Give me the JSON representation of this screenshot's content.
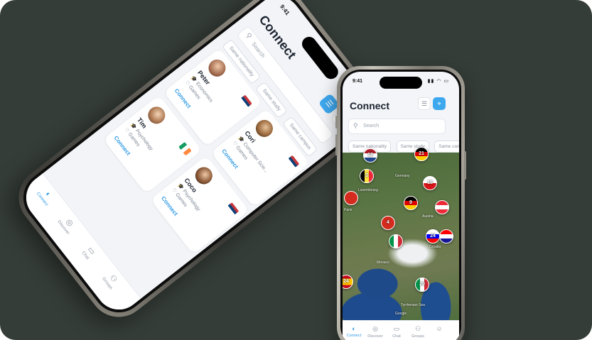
{
  "left_phone": {
    "time": "9:41",
    "title": "Connect",
    "search_placeholder": "Search",
    "filters": [
      "Same nationality",
      "Same study",
      "Same campus"
    ],
    "cards": [
      {
        "name": "Peter",
        "study": "Economics",
        "interest": "Games",
        "action": "Connect",
        "flag": "serbia"
      },
      {
        "name": "Cori",
        "study": "Computer Scie...",
        "interest": "Games",
        "action": "Connect",
        "flag": "serbia"
      },
      {
        "name": "Tim",
        "study": "Psychology",
        "interest": "Games",
        "action": "Connect",
        "flag": "ireland"
      },
      {
        "name": "Coco",
        "study": "Psychology",
        "interest": "Games",
        "action": "Connect",
        "flag": "serbia"
      }
    ],
    "tabs": [
      {
        "label": "Connect",
        "icon": "connect-icon",
        "active": true
      },
      {
        "label": "Discover",
        "icon": "compass-icon",
        "active": false
      },
      {
        "label": "Chat",
        "icon": "chat-icon",
        "active": false
      },
      {
        "label": "Groups",
        "icon": "groups-icon",
        "active": false
      }
    ]
  },
  "right_phone": {
    "time": "9:41",
    "title": "Connect",
    "search_placeholder": "Search",
    "filters": [
      "Same nationality",
      "Same study",
      "Same campus"
    ],
    "map_labels": [
      "Germany",
      "Luxembourg",
      "Paris",
      "Austria",
      "Monaco",
      "Croatia",
      "Tyrrhenian Sea",
      "Google"
    ],
    "pins": [
      {
        "count": "12",
        "flag": "netherlands"
      },
      {
        "count": "21",
        "flag": "germany"
      },
      {
        "count": "3",
        "flag": "belgium"
      },
      {
        "count": "18",
        "flag": "czechia"
      },
      {
        "count": "",
        "flag": "red"
      },
      {
        "count": "9",
        "flag": "germany"
      },
      {
        "count": "",
        "flag": "austria"
      },
      {
        "count": "4",
        "flag": "red"
      },
      {
        "count": "",
        "flag": "italy"
      },
      {
        "count": "24",
        "flag": "slovenia"
      },
      {
        "count": "",
        "flag": "croatia"
      },
      {
        "count": "24",
        "flag": "spain"
      },
      {
        "count": "20",
        "flag": "italy"
      }
    ],
    "tabs": [
      {
        "label": "Connect",
        "icon": "connect-icon",
        "active": true
      },
      {
        "label": "Discover",
        "icon": "compass-icon",
        "active": false
      },
      {
        "label": "Chat",
        "icon": "chat-icon",
        "active": false
      },
      {
        "label": "Groups",
        "icon": "groups-icon",
        "active": false
      },
      {
        "label": "",
        "icon": "profile-icon",
        "active": false
      }
    ]
  },
  "colors": {
    "background": "#353d38",
    "accent": "#3ea8ef",
    "link": "#2f9ae6"
  }
}
